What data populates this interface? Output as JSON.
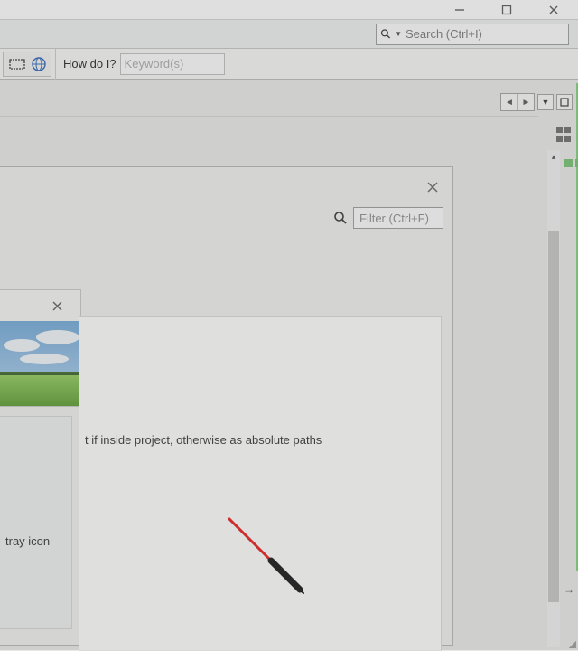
{
  "titlebar": {
    "minimize": "—",
    "maximize": "❐",
    "close": "✕"
  },
  "search": {
    "placeholder": "Search (Ctrl+I)"
  },
  "help": {
    "label": "How do I?",
    "placeholder": "Keyword(s)"
  },
  "filter": {
    "placeholder": "Filter (Ctrl+F)"
  },
  "inner": {
    "desc": "t if inside project, otherwise as absolute paths"
  },
  "tray": {
    "label": "tray icon"
  },
  "icons": {
    "chip": "chip-icon",
    "globe": "globe-icon",
    "search": "search-icon"
  },
  "colors": {
    "accent_green": "#72c06e",
    "pen_red": "#e51919",
    "pen_black": "#111111"
  }
}
